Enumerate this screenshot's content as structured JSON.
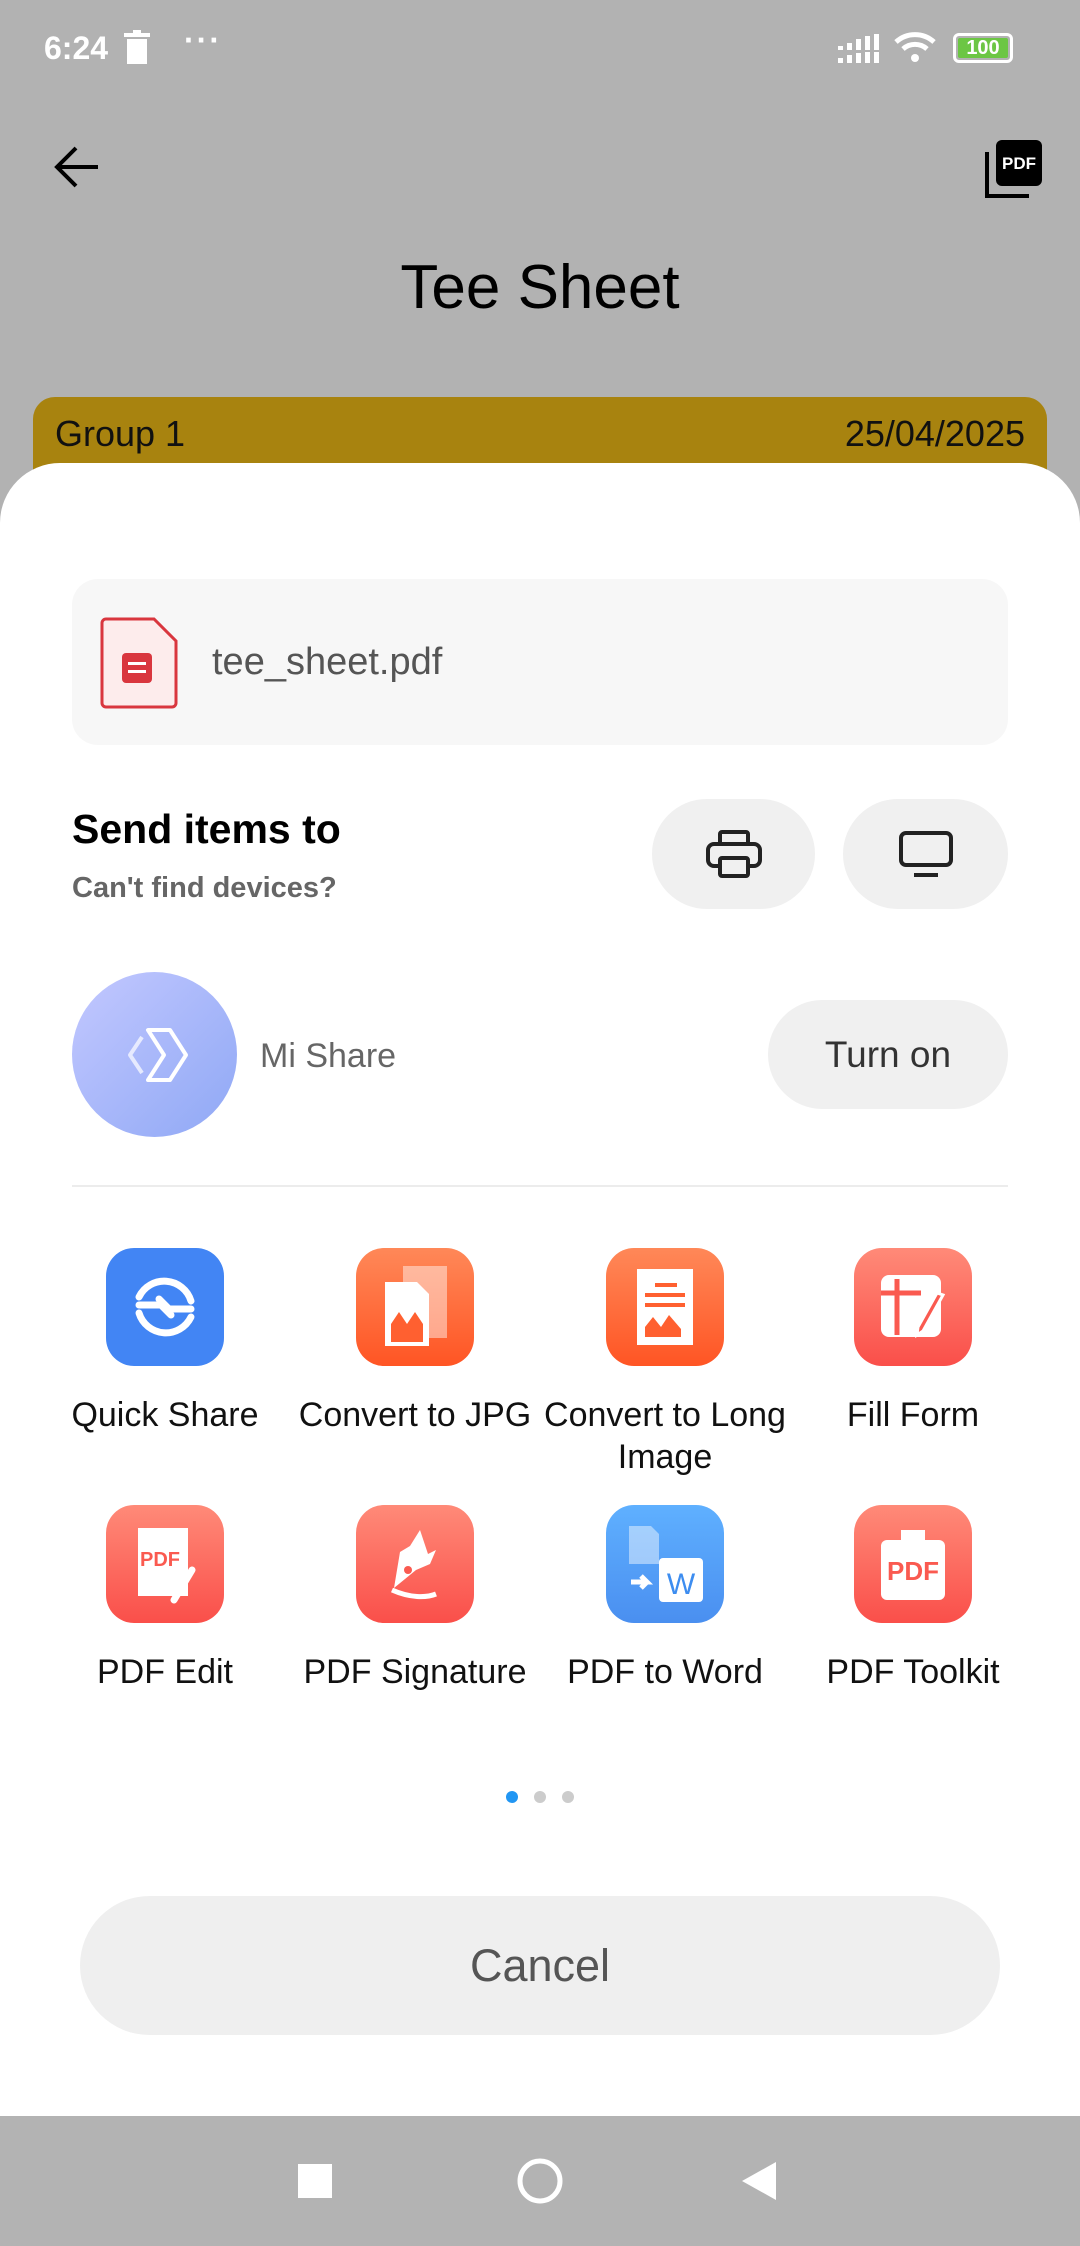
{
  "status_bar": {
    "time": "6:24",
    "battery": "100",
    "overflow": "···"
  },
  "header": {
    "title": "Tee Sheet",
    "back_icon": "arrow-left-icon",
    "action_icon": "pdf-icon"
  },
  "group_bar": {
    "label": "Group 1",
    "date": "25/04/2025",
    "color": "#a8830f"
  },
  "share_sheet": {
    "file_name": "tee_sheet.pdf",
    "send_title": "Send items to",
    "send_subtitle": "Can't find devices?",
    "mishare_label": "Mi Share",
    "turn_on_label": "Turn on",
    "apps": [
      {
        "label": "Quick Share",
        "icon": "quick-share-icon"
      },
      {
        "label": "Convert to JPG",
        "icon": "convert-jpg-icon"
      },
      {
        "label": "Convert to Long Image",
        "icon": "long-image-icon"
      },
      {
        "label": "Fill Form",
        "icon": "fill-form-icon"
      },
      {
        "label": "PDF Edit",
        "icon": "pdf-edit-icon"
      },
      {
        "label": "PDF Signature",
        "icon": "pdf-signature-icon"
      },
      {
        "label": "PDF to Word",
        "icon": "pdf-to-word-icon"
      },
      {
        "label": "PDF Toolkit",
        "icon": "pdf-toolkit-icon"
      }
    ],
    "pdf_badge": "PDF",
    "word_badge": "W",
    "page_count": 3,
    "current_page": 1,
    "cancel_label": "Cancel",
    "accent": "#2196f3"
  }
}
